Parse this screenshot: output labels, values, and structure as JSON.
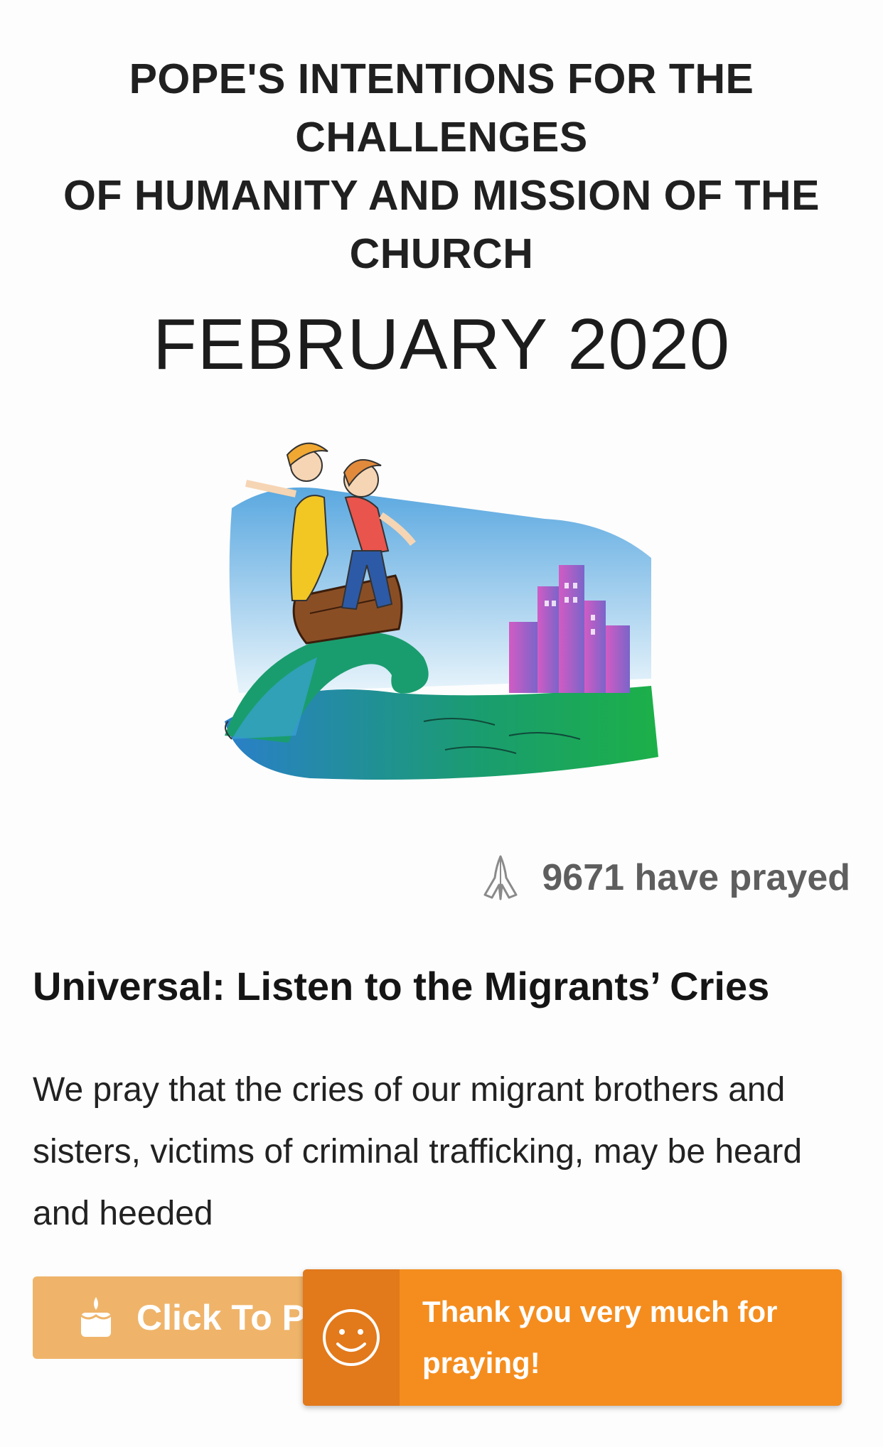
{
  "header": {
    "heading": "POPE'S INTENTIONS FOR THE CHALLENGES\nOF HUMANITY AND MISSION OF THE CHURCH",
    "month": "FEBRUARY 2020"
  },
  "stats": {
    "prayed_count_text": "9671 have prayed",
    "icon": "praying-hands-icon"
  },
  "intention": {
    "title": "Universal: Listen to the Migrants’ Cries",
    "text": "We pray that the cries of our migrant brothers and sisters, victims of criminal trafficking, may be heard and heeded"
  },
  "actions": {
    "pray_button_label": "Click To Pray",
    "pray_button_icon": "candle-icon"
  },
  "toast": {
    "message": "Thank you very much for praying!",
    "icon": "smiley-icon"
  },
  "colors": {
    "button": "#efb46a",
    "toast": "#f48d1e",
    "toast_icon_bg": "#e2791b"
  }
}
